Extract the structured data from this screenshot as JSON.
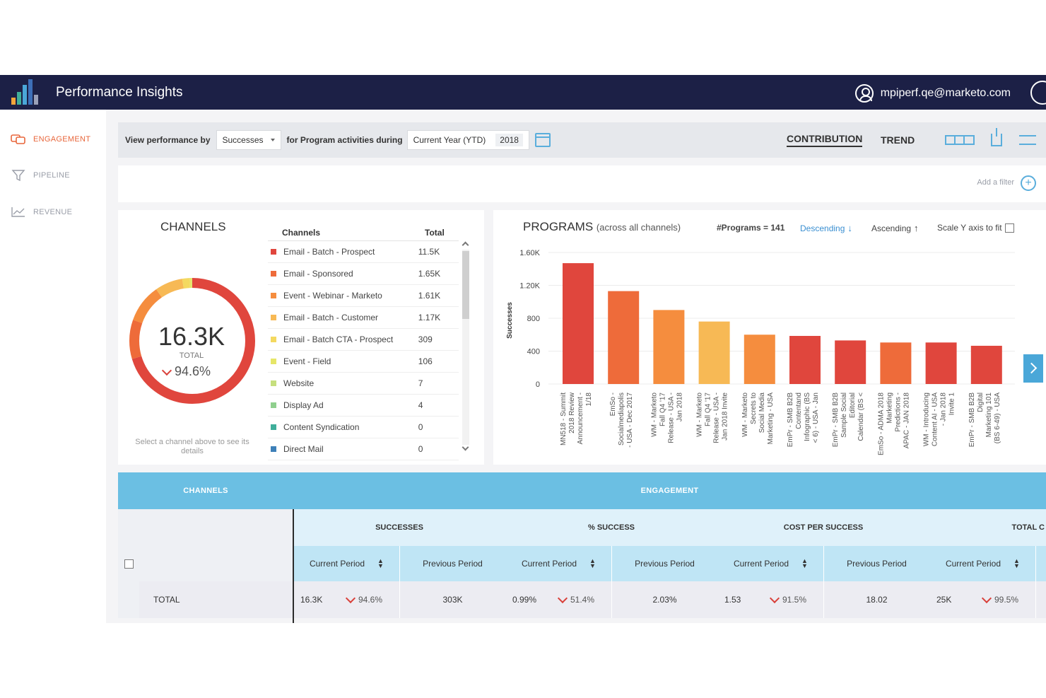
{
  "app": {
    "title": "Performance Insights",
    "user_email": "mpiperf.qe@marketo.com"
  },
  "sidebar": {
    "items": [
      {
        "label": "ENGAGEMENT",
        "icon": "chat-bubbles-icon",
        "active": true
      },
      {
        "label": "PIPELINE",
        "icon": "funnel-icon",
        "active": false
      },
      {
        "label": "REVENUE",
        "icon": "line-chart-icon",
        "active": false
      }
    ]
  },
  "toolbar": {
    "view_by_label": "View performance by",
    "metric_value": "Successes",
    "activities_label": "for Program activities during",
    "period_value": "Current Year (YTD)",
    "year_value": "2018",
    "tab_contribution": "CONTRIBUTION",
    "tab_trend": "TREND"
  },
  "filters": {
    "add_filter_label": "Add a filter"
  },
  "channels": {
    "title": "CHANNELS",
    "total_value": "16.3K",
    "total_label": "TOTAL",
    "total_change": "94.6%",
    "hint": "Select a channel above to see its details",
    "table_headers": [
      "Channels",
      "Total"
    ],
    "rows": [
      {
        "name": "Email - Batch - Prospect",
        "total": "11.5K",
        "color": "#e0463d"
      },
      {
        "name": "Email - Sponsored",
        "total": "1.65K",
        "color": "#ee6b3a"
      },
      {
        "name": "Event - Webinar - Marketo",
        "total": "1.61K",
        "color": "#f58d3e"
      },
      {
        "name": "Email - Batch - Customer",
        "total": "1.17K",
        "color": "#f7b955"
      },
      {
        "name": "Email - Batch CTA - Prospect",
        "total": "309",
        "color": "#f4d960"
      },
      {
        "name": "Event - Field",
        "total": "106",
        "color": "#e6e668"
      },
      {
        "name": "Website",
        "total": "7",
        "color": "#c6df7e"
      },
      {
        "name": "Display Ad",
        "total": "4",
        "color": "#8fcf8e"
      },
      {
        "name": "Content Syndication",
        "total": "0",
        "color": "#3fae9a"
      },
      {
        "name": "Direct Mail",
        "total": "0",
        "color": "#3d80b8"
      }
    ]
  },
  "programs": {
    "title": "PROGRAMS",
    "subtitle": "(across all channels)",
    "count_label": "#Programs = 141",
    "descending_label": "Descending",
    "ascending_label": "Ascending",
    "scale_label": "Scale Y axis to fit"
  },
  "chart_data": {
    "type": "bar",
    "title": "PROGRAMS (across all channels)",
    "ylabel": "Successes",
    "ylim": [
      0,
      1600
    ],
    "yticks": [
      "0",
      "400",
      "800",
      "1.20K",
      "1.60K"
    ],
    "categories": [
      "MN518 - Summit 2018 Review Announcement - 1/18",
      "EmSo - Socialmediapolis - USA - Dec 2017",
      "WM - Marketo Fall Q4 '17 Release - USA - Jan 2018",
      "WM - Marketo Fall Q4 '17 Release - USA - Jan 2018 Invite 1",
      "WM - Marketo Secrets to Social Media Marketing - USA - Jan 2018",
      "EmPr - SMB B2B Contentand Infographic (BS < 6) - USA - Jan 2018",
      "EmPr - SMB B2B Sample Social Editorial Calendar (BS < 6)",
      "EmSo - ADMA 2018 Marketing Predictions - APAC - JAN 2018",
      "WM - Introducing Content AI - USA - Jan 2018 Invite 1",
      "EmPr - SMB B2B Digital Marketing 101 (BS 6-49) - USA - Jan 2018"
    ],
    "values": [
      1470,
      1130,
      900,
      760,
      600,
      585,
      530,
      505,
      505,
      465
    ],
    "bar_colors": [
      "#e0463d",
      "#ee6b3a",
      "#f58d3e",
      "#f7b955",
      "#f58d3e",
      "#e0463d",
      "#e0463d",
      "#ee6b3a",
      "#e0463d",
      "#e0463d"
    ],
    "grid": true,
    "legend": "none"
  },
  "grid": {
    "channels_header": "CHANNELS",
    "engagement_header": "ENGAGEMENT",
    "groups": [
      "SUCCESSES",
      "% SUCCESS",
      "COST PER SUCCESS",
      "TOTAL C"
    ],
    "current_label": "Current Period",
    "previous_label": "Previous Period",
    "total_row": {
      "label": "TOTAL",
      "successes_current": "16.3K",
      "successes_change": "94.6%",
      "successes_previous": "303K",
      "pct_current": "0.99%",
      "pct_change": "51.4%",
      "pct_previous": "2.03%",
      "cost_current": "1.53",
      "cost_change": "91.5%",
      "cost_previous": "18.02",
      "totalc_current": "25K",
      "totalc_change": "99.5%"
    }
  }
}
